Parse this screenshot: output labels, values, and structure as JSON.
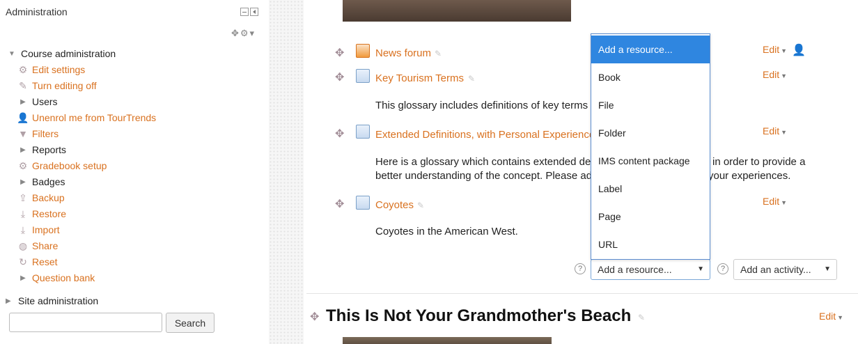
{
  "admin": {
    "title": "Administration",
    "course_admin": "Course administration",
    "items": [
      {
        "label": "Edit settings",
        "icon": "gear-icon",
        "link": true
      },
      {
        "label": "Turn editing off",
        "icon": "pencil-icon",
        "link": true
      },
      {
        "label": "Users",
        "icon": "triangle-right-icon",
        "link": false
      },
      {
        "label": "Unenrol me from TourTrends",
        "icon": "user-icon",
        "link": true
      },
      {
        "label": "Filters",
        "icon": "filter-icon",
        "link": true
      },
      {
        "label": "Reports",
        "icon": "triangle-right-icon",
        "link": false
      },
      {
        "label": "Gradebook setup",
        "icon": "gear-icon",
        "link": true
      },
      {
        "label": "Badges",
        "icon": "triangle-right-icon",
        "link": false
      },
      {
        "label": "Backup",
        "icon": "upload-icon",
        "link": true
      },
      {
        "label": "Restore",
        "icon": "download-icon",
        "link": true
      },
      {
        "label": "Import",
        "icon": "download-icon",
        "link": true
      },
      {
        "label": "Share",
        "icon": "globe-icon",
        "link": true
      },
      {
        "label": "Reset",
        "icon": "refresh-icon",
        "link": true
      },
      {
        "label": "Question bank",
        "icon": "triangle-right-icon",
        "link": true
      }
    ],
    "site_admin": "Site administration",
    "search_button": "Search"
  },
  "activities": [
    {
      "name": "News forum",
      "type": "forum"
    },
    {
      "name": "Key Tourism Terms",
      "type": "glossary"
    },
    {
      "name": "Extended Definitions, with Personal Experience",
      "type": "glossary"
    },
    {
      "name": "Coyotes",
      "type": "glossary"
    }
  ],
  "descriptions": {
    "key_terms": "This glossary includes definitions of key terms",
    "extended_1": "Here is a glossary which contains extended de",
    "extended_1_tail": "in order to provide a",
    "extended_2": "better understanding of the concept. Please ad",
    "extended_2_tail": "your experiences.",
    "coyotes": "Coyotes in the American West."
  },
  "edit_label": "Edit",
  "resource_select": "Add a resource...",
  "activity_select": "Add an activity...",
  "help_glyph": "?",
  "section_title": "This Is Not Your Grandmother's Beach",
  "dropdown_options": [
    "Add a resource...",
    "Book",
    "File",
    "Folder",
    "IMS content package",
    "Label",
    "Page",
    "URL"
  ],
  "colors": {
    "link": "#d9711f",
    "highlight": "#2f86e0",
    "icon": "#b0a0a6"
  }
}
